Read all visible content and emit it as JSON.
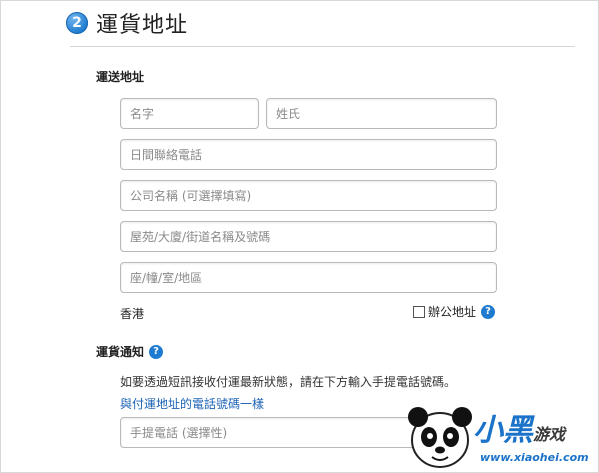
{
  "header": {
    "step_number": "2",
    "title": "運貨地址"
  },
  "shipping": {
    "section_title": "運送地址",
    "first_name_placeholder": "名字",
    "last_name_placeholder": "姓氏",
    "daytime_phone_placeholder": "日間聯絡電話",
    "company_placeholder": "公司名稱 (可選擇填寫)",
    "street_placeholder": "屋苑/大廈/街道名稱及號碼",
    "unit_placeholder": "座/幢/室/地區",
    "region": "香港",
    "office_checkbox_label": "辦公地址"
  },
  "notification": {
    "section_title": "運貨通知",
    "description": "如要透過短訊接收付運最新狀態，請在下方輸入手提電話號碼。",
    "same_as_link": "與付運地址的電話號碼一樣",
    "mobile_placeholder": "手提電話 (選擇性)"
  },
  "icons": {
    "help": "?",
    "help_color": "#1f7bd0"
  },
  "watermark": {
    "main": "小黑",
    "sub": "游戏",
    "url": "www.xiaohei.com"
  }
}
